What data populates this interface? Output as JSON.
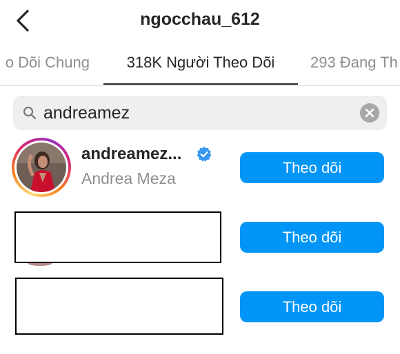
{
  "header": {
    "title": "ngocchau_612",
    "back_icon": "chevron-left-icon"
  },
  "tabs": [
    {
      "label": "o Dõi Chung",
      "active": false
    },
    {
      "label": "318K Người Theo Dõi",
      "active": true
    },
    {
      "label": "293 Đang Th",
      "active": false
    }
  ],
  "search": {
    "value": "andreamez",
    "icon": "search-icon",
    "clear_icon": "clear-icon"
  },
  "results": [
    {
      "username": "andreamez...",
      "verified": true,
      "full_name": "Andrea Meza",
      "button_label": "Theo dõi"
    },
    {
      "button_label": "Theo dõi"
    },
    {
      "button_label": "Theo dõi"
    }
  ],
  "colors": {
    "accent": "#0095f6",
    "text": "#262626",
    "secondary_text": "#8e8e8e",
    "search_bg": "#efefef",
    "verified": "#3897f0"
  }
}
